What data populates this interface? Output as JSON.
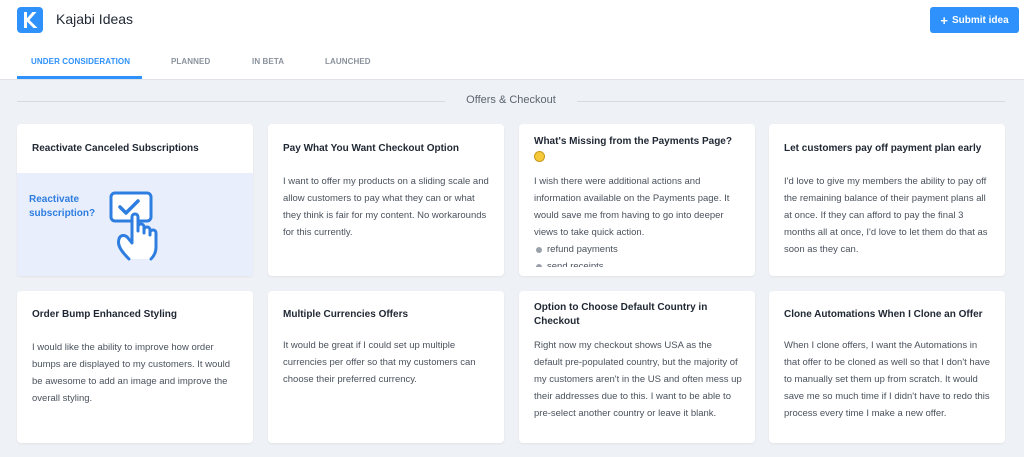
{
  "header": {
    "app_title": "Kajabi Ideas",
    "submit_label": "Submit idea",
    "submit_icon": "plus-icon",
    "brand_color": "#2e91fc"
  },
  "tabs": [
    {
      "label": "UNDER CONSIDERATION",
      "active": true
    },
    {
      "label": "PLANNED",
      "active": false
    },
    {
      "label": "IN BETA",
      "active": false
    },
    {
      "label": "LAUNCHED",
      "active": false
    }
  ],
  "section": {
    "title": "Offers & Checkout"
  },
  "cards": [
    {
      "title": "Reactivate Canceled Subscriptions",
      "image_text_line1": "Reactivate",
      "image_text_line2": "subscription?",
      "image_icon": "hand-pointer-icon"
    },
    {
      "title": "Pay What You Want Checkout Option",
      "body": "I want to offer my products on a sliding scale and allow customers to pay what they can or what they think is fair for my content. No workarounds for this currently."
    },
    {
      "title": "What's Missing from the Payments Page?",
      "title_icon": "emoji-icon",
      "body": "I wish there were additional actions and information available on the Payments page. It would save me from having to go into deeper views to take quick action.",
      "bullets": [
        "refund payments",
        "send receipts"
      ]
    },
    {
      "title": "Let customers pay off payment plan early",
      "body": "I'd love to give my members the ability to pay off the remaining balance of their payment plans all at once. If they can afford to pay the final 3 months all at once, I'd love to let them do that as soon as they can."
    },
    {
      "title": "Order Bump Enhanced Styling",
      "body": "I would like the ability to improve how order bumps are displayed to my customers. It would be awesome to add an image and improve the overall styling."
    },
    {
      "title": "Multiple Currencies Offers",
      "body": "It would be great if I could set up multiple currencies per offer so that my customers can choose their preferred currency."
    },
    {
      "title": "Option to Choose Default Country in Checkout",
      "body": "Right now my checkout shows USA as the default pre-populated country, but the majority of my customers aren't in the US and often mess up their addresses due to this. I want to be able to pre-select another country or leave it blank."
    },
    {
      "title": "Clone Automations When I Clone an Offer",
      "body": "When I clone offers, I want the Automations in that offer to be cloned as well so that I don't have to manually set them up from scratch. It would save me so much time if I didn't have to redo this process every time I make a new offer."
    }
  ]
}
